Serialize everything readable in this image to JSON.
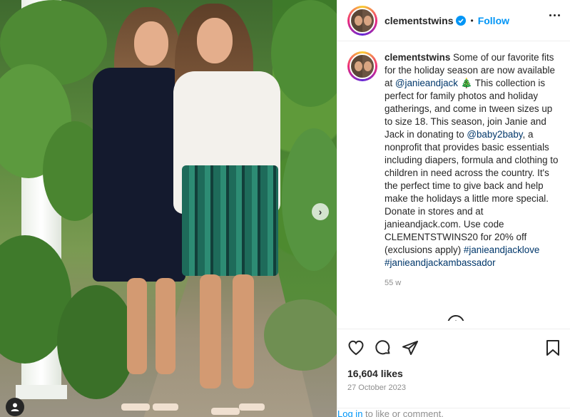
{
  "post": {
    "username": "clementstwins",
    "follow_label": "Follow",
    "separator": "•",
    "caption": {
      "username": "clementstwins",
      "parts": [
        {
          "t": " Some of our favorite fits for the holiday season are now available at "
        },
        {
          "t": "@janieandjack",
          "link": true
        },
        {
          "t": " 🎄 This collection is perfect for family photos and holiday gatherings, and come in tween sizes up to size 18. This season, join Janie and Jack in donating to "
        },
        {
          "t": "@baby2baby",
          "link": true
        },
        {
          "t": ", a nonprofit that provides basic essentials including diapers, formula and clothing to children in need across the country. It's the perfect time to give back and help make the holidays a little more special. Donate in stores and at janieandjack.com. Use code CLEMENTSTWINS20 for 20% off (exclusions apply) "
        },
        {
          "t": "#janieandjacklove",
          "link": true
        },
        {
          "t": " "
        },
        {
          "t": "#janieandjackambassador",
          "link": true
        }
      ],
      "time_ago": "55 w"
    },
    "likes": "16,604 likes",
    "date": "27 October 2023",
    "login_link": "Log in",
    "login_rest": " to like or comment.",
    "add_comment_symbol": "+"
  },
  "icons": {
    "header_verified": "verified-badge-icon",
    "more": "more-options-icon",
    "like": "heart-icon",
    "comment": "comment-bubble-icon",
    "share": "paper-plane-icon",
    "save": "bookmark-icon",
    "next": "chevron-right-icon",
    "tag": "user-tag-icon"
  },
  "colors": {
    "accent": "#0095f6",
    "link": "#00376b",
    "muted": "#8e8e8e",
    "text": "#262626"
  },
  "media": {
    "next_glyph": "›"
  }
}
